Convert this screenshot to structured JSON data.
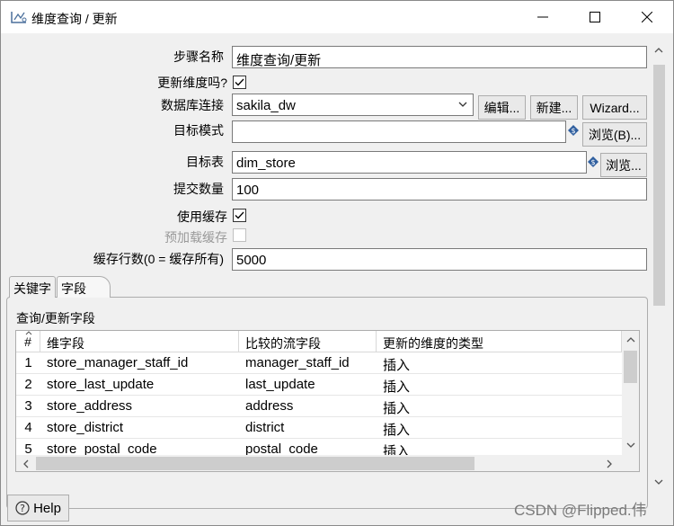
{
  "window": {
    "title": "维度查询 / 更新"
  },
  "form": {
    "step_name_label": "步骤名称",
    "step_name_value": "维度查询/更新",
    "update_dimension_label": "更新维度吗?",
    "update_dimension_checked": true,
    "db_connection_label": "数据库连接",
    "db_connection_value": "sakila_dw",
    "edit_button": "编辑...",
    "new_button": "新建...",
    "wizard_button": "Wizard...",
    "target_schema_label": "目标模式",
    "target_schema_value": "",
    "browse_b_button": "浏览(B)...",
    "target_table_label": "目标表",
    "target_table_value": "dim_store",
    "browse_button": "浏览...",
    "commit_size_label": "提交数量",
    "commit_size_value": "100",
    "use_cache_label": "使用缓存",
    "use_cache_checked": true,
    "preload_cache_label": "预加载缓存",
    "preload_cache_checked": false,
    "cache_rows_label": "缓存行数(0 = 缓存所有)",
    "cache_rows_value": "5000"
  },
  "tabs": [
    {
      "label": "关键字",
      "active": false
    },
    {
      "label": "字段",
      "active": true
    }
  ],
  "fields_section": {
    "title": "查询/更新字段",
    "columns": [
      "#",
      "维字段",
      "比较的流字段",
      "更新的维度的类型"
    ],
    "rows": [
      {
        "num": "1",
        "dim_field": "store_manager_staff_id",
        "stream_field": "manager_staff_id",
        "type": "插入"
      },
      {
        "num": "2",
        "dim_field": "store_last_update",
        "stream_field": "last_update",
        "type": "插入"
      },
      {
        "num": "3",
        "dim_field": "store_address",
        "stream_field": "address",
        "type": "插入"
      },
      {
        "num": "4",
        "dim_field": "store_district",
        "stream_field": "district",
        "type": "插入"
      },
      {
        "num": "5",
        "dim_field": "store_postal_code",
        "stream_field": "postal_code",
        "type": "插入"
      }
    ]
  },
  "help_button": "Help",
  "watermark": "CSDN @Flipped.伟",
  "colors": {
    "variable_icon": "#2f5f9f",
    "scroll_thumb": "#cdcdcd"
  }
}
